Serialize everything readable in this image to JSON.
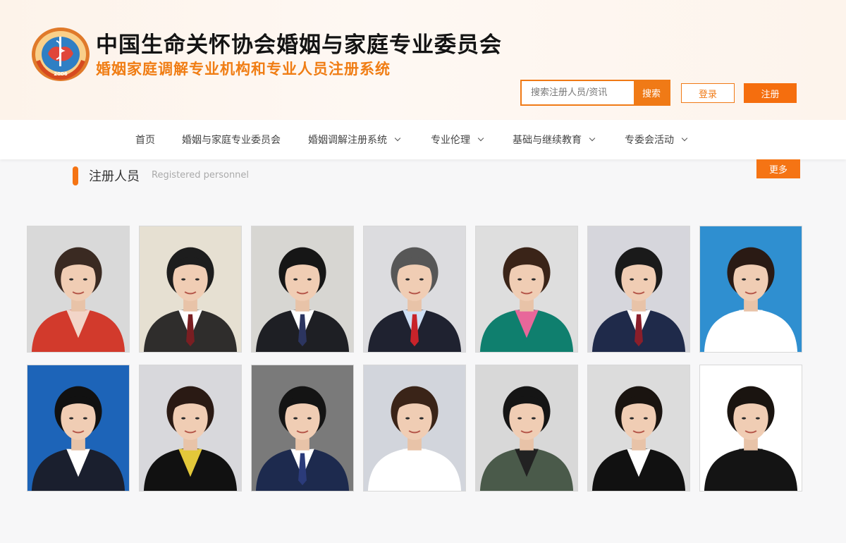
{
  "header": {
    "logo_text": "CHINESE ASSOCIATION FOR LIFE CARE 2006",
    "title": "中国生命关怀协会婚姻与家庭专业委员会",
    "subtitle": "婚姻家庭调解专业机构和专业人员注册系统",
    "search_placeholder": "搜索注册人员/资讯",
    "search_button": "搜索",
    "login_button": "登录",
    "register_button": "注册"
  },
  "nav": {
    "items": [
      {
        "label": "首页",
        "dropdown": false
      },
      {
        "label": "婚姻与家庭专业委员会",
        "dropdown": false
      },
      {
        "label": "婚姻调解注册系统",
        "dropdown": true
      },
      {
        "label": "专业伦理",
        "dropdown": true
      },
      {
        "label": "基础与继续教育",
        "dropdown": true
      },
      {
        "label": "专委会活动",
        "dropdown": true
      }
    ]
  },
  "section": {
    "title": "注册人员",
    "subtitle": "Registered personnel",
    "more_button": "更多"
  },
  "colors": {
    "accent": "#f07a16",
    "title_orange": "#f07d14",
    "bg": "#f7f7f8"
  },
  "personnel": [
    {
      "bg": "#d9d9d9",
      "suit": "#d23a2c",
      "shirt": "#f2d5c8",
      "hair": "#3a2a22",
      "tie": "none"
    },
    {
      "bg": "#e6e0d2",
      "suit": "#2f2d2c",
      "shirt": "#ffffff",
      "hair": "#1d1d1d",
      "tie": "#7a1e22"
    },
    {
      "bg": "#d7d6d2",
      "suit": "#1e1f24",
      "shirt": "#ffffff",
      "hair": "#161616",
      "tie": "#2c3560"
    },
    {
      "bg": "#dcdcdf",
      "suit": "#1f2230",
      "shirt": "#cfe0f5",
      "hair": "#575757",
      "tie": "#c8232a"
    },
    {
      "bg": "#dedede",
      "suit": "#0f7f6e",
      "shirt": "#e8679a",
      "hair": "#3a2418",
      "tie": "none"
    },
    {
      "bg": "#d6d6dc",
      "suit": "#1f2a4a",
      "shirt": "#ffffff",
      "hair": "#1a1a1a",
      "tie": "#8a1e2a"
    },
    {
      "bg": "#2f8fd0",
      "suit": "#ffffff",
      "shirt": "#ffffff",
      "hair": "#2a1a14",
      "tie": "none"
    },
    {
      "bg": "#1d64b8",
      "suit": "#1a1f2e",
      "shirt": "#ffffff",
      "hair": "#111111",
      "tie": "none"
    },
    {
      "bg": "#d8d8dc",
      "suit": "#111111",
      "shirt": "#e3c83a",
      "hair": "#2a1a14",
      "tie": "none"
    },
    {
      "bg": "#7a7a7a",
      "suit": "#1d2a4e",
      "shirt": "#ffffff",
      "hair": "#141414",
      "tie": "#2b3b7a"
    },
    {
      "bg": "#d2d5dc",
      "suit": "#ffffff",
      "shirt": "#ffffff",
      "hair": "#3a2418",
      "tie": "none"
    },
    {
      "bg": "#d8d8d8",
      "suit": "#4a5a4a",
      "shirt": "#222222",
      "hair": "#151515",
      "tie": "none"
    },
    {
      "bg": "#dcdcdc",
      "suit": "#111111",
      "shirt": "#ffffff",
      "hair": "#1a1410",
      "tie": "none"
    },
    {
      "bg": "#ffffff",
      "suit": "#141414",
      "shirt": "#141414",
      "hair": "#1a1410",
      "tie": "none"
    }
  ]
}
